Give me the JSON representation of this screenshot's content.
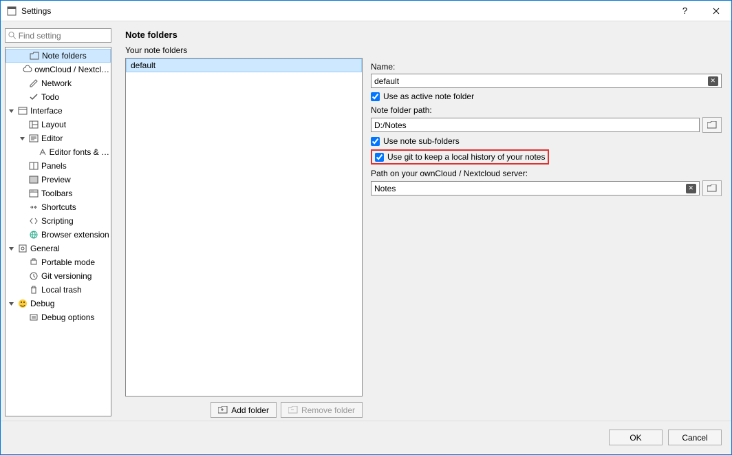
{
  "window": {
    "title": "Settings"
  },
  "search": {
    "placeholder": "Find setting"
  },
  "tree": [
    {
      "indent": 1,
      "twisty": "",
      "icon": "folder",
      "label": "Note folders",
      "selected": true
    },
    {
      "indent": 1,
      "twisty": "",
      "icon": "cloud",
      "label": "ownCloud / Nextcl…"
    },
    {
      "indent": 1,
      "twisty": "",
      "icon": "pencil",
      "label": "Network"
    },
    {
      "indent": 1,
      "twisty": "",
      "icon": "check",
      "label": "Todo"
    },
    {
      "indent": 0,
      "twisty": "v",
      "icon": "window",
      "label": "Interface"
    },
    {
      "indent": 1,
      "twisty": "",
      "icon": "layout",
      "label": "Layout"
    },
    {
      "indent": 1,
      "twisty": "v",
      "icon": "edit",
      "label": "Editor"
    },
    {
      "indent": 2,
      "twisty": "",
      "icon": "font",
      "label": "Editor fonts & …"
    },
    {
      "indent": 1,
      "twisty": "",
      "icon": "panels",
      "label": "Panels"
    },
    {
      "indent": 1,
      "twisty": "",
      "icon": "preview",
      "label": "Preview"
    },
    {
      "indent": 1,
      "twisty": "",
      "icon": "toolbar",
      "label": "Toolbars"
    },
    {
      "indent": 1,
      "twisty": "",
      "icon": "shortcuts",
      "label": "Shortcuts"
    },
    {
      "indent": 1,
      "twisty": "",
      "icon": "script",
      "label": "Scripting"
    },
    {
      "indent": 1,
      "twisty": "",
      "icon": "globe",
      "label": "Browser extension"
    },
    {
      "indent": 0,
      "twisty": "v",
      "icon": "general",
      "label": "General"
    },
    {
      "indent": 1,
      "twisty": "",
      "icon": "portable",
      "label": "Portable mode"
    },
    {
      "indent": 1,
      "twisty": "",
      "icon": "clock",
      "label": "Git versioning"
    },
    {
      "indent": 1,
      "twisty": "",
      "icon": "trash",
      "label": "Local trash"
    },
    {
      "indent": 0,
      "twisty": "v",
      "icon": "smile",
      "label": "Debug"
    },
    {
      "indent": 1,
      "twisty": "",
      "icon": "debug",
      "label": "Debug options"
    }
  ],
  "main": {
    "title": "Note folders",
    "subtitle": "Your note folders",
    "items": [
      "default"
    ],
    "addBtn": "Add folder",
    "removeBtn": "Remove folder",
    "nameLabel": "Name:",
    "nameValue": "default",
    "useActive": "Use as active note folder",
    "pathLabel": "Note folder path:",
    "pathValue": "D:/Notes",
    "useSub": "Use note sub-folders",
    "useGit": "Use git to keep a local history of your notes",
    "cloudLabel": "Path on your ownCloud / Nextcloud server:",
    "cloudValue": "Notes"
  },
  "footer": {
    "ok": "OK",
    "cancel": "Cancel"
  }
}
